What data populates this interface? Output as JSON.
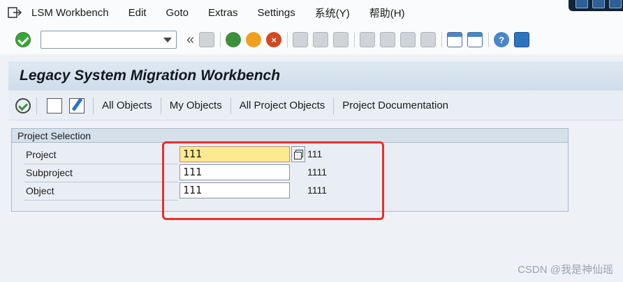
{
  "menubar": {
    "items": [
      "LSM Workbench",
      "Edit",
      "Goto",
      "Extras",
      "Settings",
      "系统(Y)",
      "帮助(H)"
    ]
  },
  "toolbar": {
    "command_field_value": "",
    "back_symbol": "«"
  },
  "title": "Legacy System Migration Workbench",
  "app_toolbar": {
    "buttons": [
      "All Objects",
      "My Objects",
      "All Project Objects",
      "Project Documentation"
    ]
  },
  "project_selection": {
    "title": "Project Selection",
    "rows": [
      {
        "label": "Project",
        "value": "111",
        "description": "111"
      },
      {
        "label": "Subproject",
        "value": "111",
        "description": "1111"
      },
      {
        "label": "Object",
        "value": "111",
        "description": "1111"
      }
    ]
  },
  "colors": {
    "annotation": "#e8302a",
    "focused_field": "#fde98f",
    "title_background": "#dfe9f3"
  },
  "watermark": "CSDN @我是神仙瑶"
}
